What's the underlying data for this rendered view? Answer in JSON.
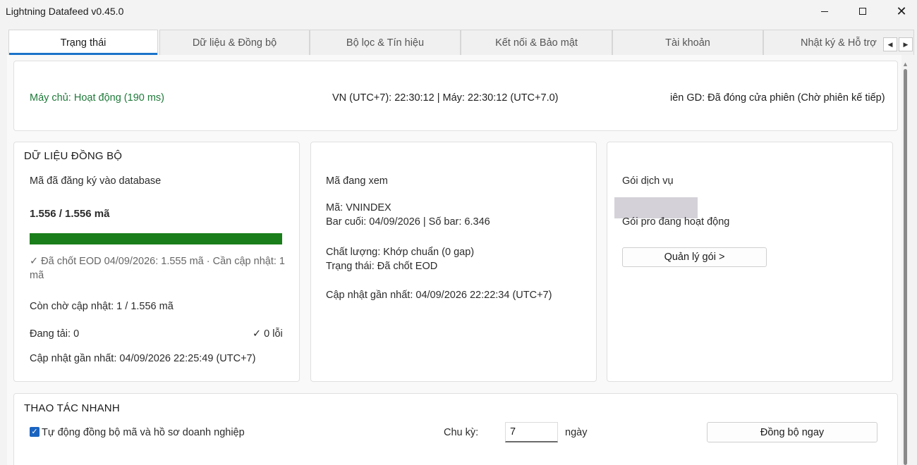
{
  "window": {
    "title": "Lightning Datafeed v0.45.0"
  },
  "tabs": [
    {
      "label": "Trạng thái",
      "active": true
    },
    {
      "label": "Dữ liệu & Đồng bộ",
      "active": false
    },
    {
      "label": "Bộ lọc & Tín hiệu",
      "active": false
    },
    {
      "label": "Kết nối & Bảo mật",
      "active": false
    },
    {
      "label": "Tài khoản",
      "active": false
    },
    {
      "label": "Nhật ký & Hỗ trợ",
      "active": false
    }
  ],
  "status": {
    "server": "Máy chủ: Hoạt động (190 ms)",
    "clock": "VN (UTC+7): 22:30:12 | Máy: 22:30:12 (UTC+7.0)",
    "session": "iên GD: Đã đóng cửa phiên (Chờ phiên kế tiếp)"
  },
  "sync": {
    "heading": "DỮ LIỆU ĐỒNG BỘ",
    "registered_label": "Mã đã đăng ký vào database",
    "count": "1.556 / 1.556 mã",
    "progress": 1.0,
    "eod_line1": "✓ Đã chốt EOD 04/09/2026: 1.555 mã · Cần cập nhật: 1",
    "eod_line2": "mã",
    "pending": "Còn chờ cập nhật: 1 / 1.556 mã",
    "loading": "Đang tải: 0",
    "errors": "✓ 0 lỗi",
    "last_update": "Cập nhật gần nhất: 04/09/2026 22:25:49 (UTC+7)"
  },
  "viewing": {
    "label": "Mã đang xem",
    "symbol": "Mã: VNINDEX",
    "last_bar": "Bar cuối: 04/09/2026 | Số bar: 6.346",
    "quality": "Chất lượng: Khớp chuẩn (0 gap)",
    "state": "Trạng thái: Đã chốt EOD",
    "last_update": "Cập nhật gần nhất: 04/09/2026 22:22:34 (UTC+7)"
  },
  "plan": {
    "label": "Gói dịch vụ",
    "status": "Gói pro đang hoạt động",
    "manage_button": "Quản lý gói >"
  },
  "quick_actions": {
    "heading": "THAO TÁC NHANH",
    "auto_sync_label": "Tự động đồng bộ mã và hồ sơ doanh nghiệp",
    "auto_sync_checked": true,
    "cycle_label": "Chu kỳ:",
    "cycle_value": "7",
    "cycle_unit": "ngày",
    "sync_now_button": "Đồng bộ ngay"
  },
  "icons": {
    "minimize": "minimize-icon",
    "maximize": "maximize-icon",
    "close": "close-icon",
    "tab_left": "arrow-left-icon",
    "tab_right": "arrow-right-icon",
    "check": "checkmark-icon"
  },
  "colors": {
    "accent": "#1a73c9",
    "success": "#1f7a3a",
    "progress": "#1a7f1a"
  }
}
